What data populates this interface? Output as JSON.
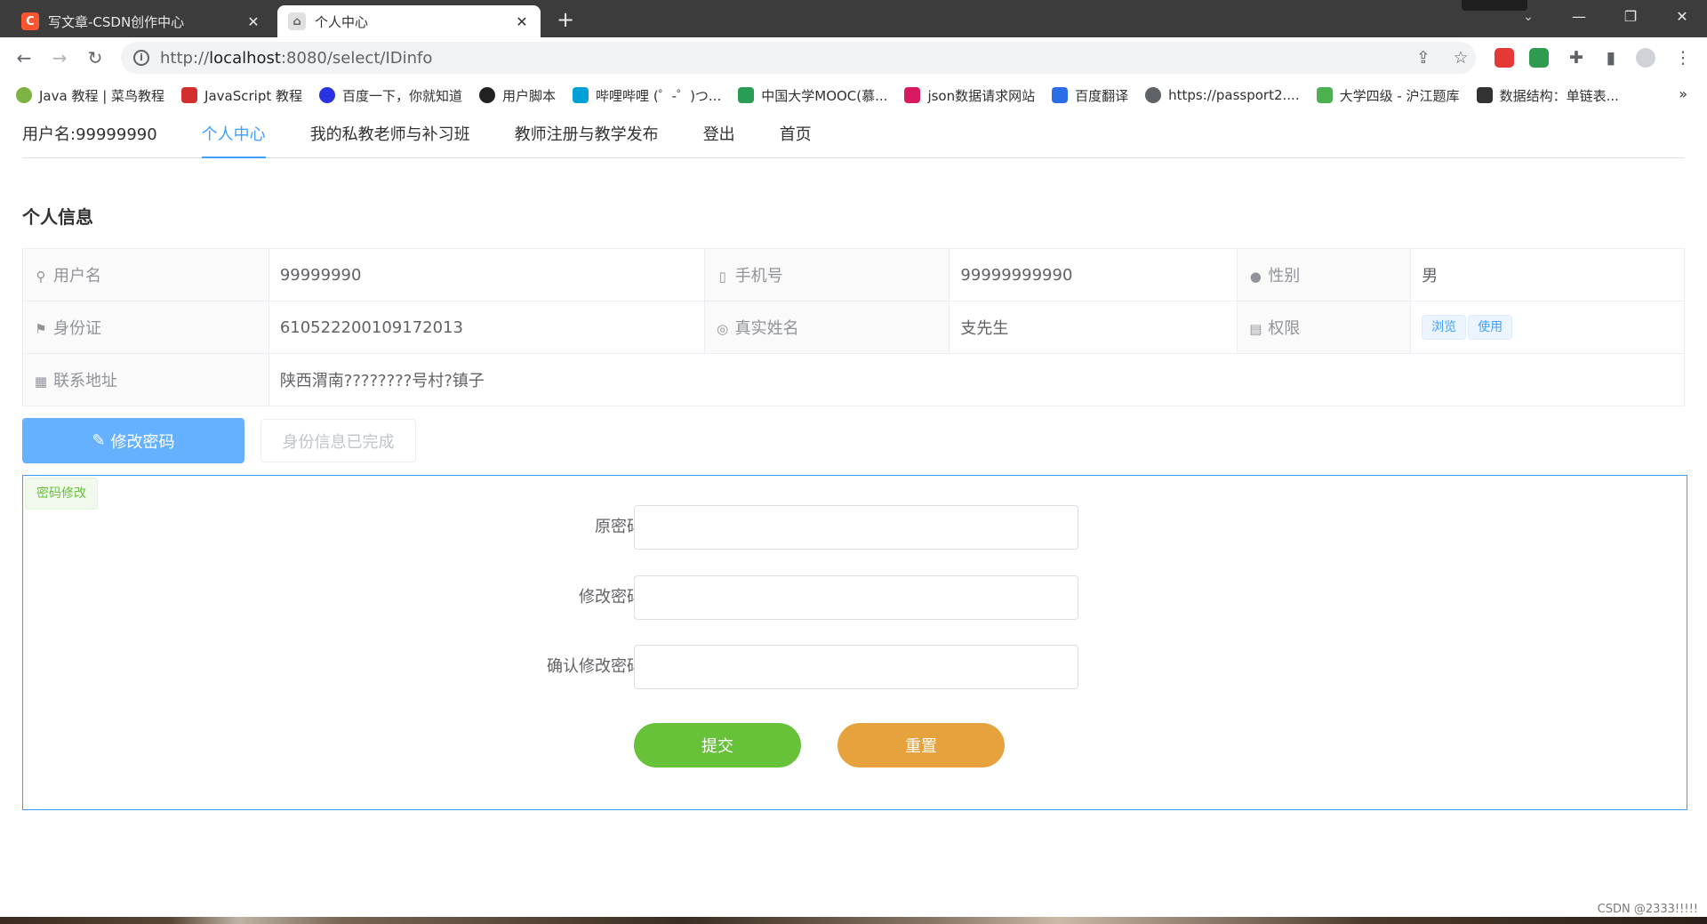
{
  "browser": {
    "tabs": [
      {
        "title": "写文章-CSDN创作中心",
        "favicon": "csdn-c-icon",
        "favicon_color": "#fc5531",
        "active": false
      },
      {
        "title": "个人中心",
        "favicon": "page-icon",
        "active": true
      }
    ],
    "new_tab_label": "+",
    "url_scheme": "http://",
    "url_host": "localhost",
    "url_rest": ":8080/select/IDinfo",
    "bookmarks": [
      {
        "label": "Java 教程 | 菜鸟教程",
        "icon": "runoob-icon",
        "color": "#7cb342"
      },
      {
        "label": "JavaScript 教程",
        "icon": "shield-icon",
        "color": "#d32f2f"
      },
      {
        "label": "百度一下，你就知道",
        "icon": "baidu-paw-icon",
        "color": "#2932e1"
      },
      {
        "label": "用户脚本",
        "icon": "script-icon",
        "color": "#222222"
      },
      {
        "label": "哔哩哔哩 (゜-゜)つ...",
        "icon": "bilibili-icon",
        "color": "#00a1d6"
      },
      {
        "label": "中国大学MOOC(慕...",
        "icon": "mooc-icon",
        "color": "#2a9d55"
      },
      {
        "label": "json数据请求网站",
        "icon": "crown-icon",
        "color": "#d81b60"
      },
      {
        "label": "百度翻译",
        "icon": "translate-icon",
        "color": "#2b6de8"
      },
      {
        "label": "https://passport2....",
        "icon": "globe-icon",
        "color": "#5f6368"
      },
      {
        "label": "大学四级 - 沪江题库",
        "icon": "hujiang-icon",
        "color": "#4caf50"
      },
      {
        "label": "数据结构：单链表...",
        "icon": "algorithm-icon",
        "color": "#333333"
      }
    ],
    "bookmarks_more": "»"
  },
  "app": {
    "menu": [
      {
        "label": "用户名:99999990",
        "active": false
      },
      {
        "label": "个人中心",
        "active": true
      },
      {
        "label": "我的私教老师与补习班",
        "active": false
      },
      {
        "label": "教师注册与教学发布",
        "active": false
      },
      {
        "label": "登出",
        "active": false
      },
      {
        "label": "首页",
        "active": false
      }
    ],
    "section_title": "个人信息",
    "info": {
      "username_label": "用户名",
      "username": "99999990",
      "phone_label": "手机号",
      "phone": "99999999990",
      "gender_label": "性别",
      "gender": "男",
      "idcard_label": "身份证",
      "idcard": "610522200109172013",
      "realname_label": "真实姓名",
      "realname": "支先生",
      "permission_label": "权限",
      "permissions": [
        "浏览",
        "使用"
      ],
      "address_label": "联系地址",
      "address": "陕西渭南????????号村?镇子"
    },
    "change_password_button": "修改密码",
    "id_done_button": "身份信息已完成",
    "password_panel": {
      "tag": "密码修改",
      "old_password_label": "原密码",
      "new_password_label": "修改密码",
      "confirm_password_label": "确认修改密码",
      "submit": "提交",
      "reset": "重置"
    },
    "colors": {
      "primary": "#409eff",
      "primary_light": "#66b1ff",
      "success": "#67c23a",
      "warning": "#e6a23c"
    }
  },
  "watermark": "CSDN @2333!!!!!"
}
